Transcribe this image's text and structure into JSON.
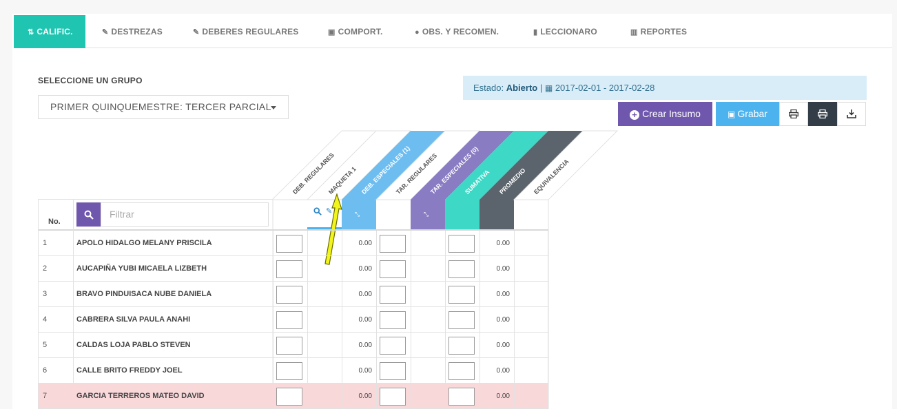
{
  "tabs": [
    {
      "label": "CALIFIC.",
      "icon": "sort-icon",
      "active": true
    },
    {
      "label": "DESTREZAS",
      "icon": "edit-icon"
    },
    {
      "label": "DEBERES REGULARES",
      "icon": "edit-icon"
    },
    {
      "label": "COMPORT.",
      "icon": "comment-box-icon"
    },
    {
      "label": "OBS. Y RECOMEN.",
      "icon": "comments-icon"
    },
    {
      "label": "LECCIONARO",
      "icon": "book-icon"
    },
    {
      "label": "REPORTES",
      "icon": "bar-chart-icon"
    }
  ],
  "group": {
    "label": "SELECCIONE UN GRUPO",
    "selected": "PRIMER QUINQUEMESTRE: TERCER PARCIAL"
  },
  "estado": {
    "prefix": "Estado:",
    "value": "Abierto",
    "separator": "|",
    "range": "2017-02-01 - 2017-02-28"
  },
  "actions": {
    "crear": "Crear Insumo",
    "grabar": "Grabar"
  },
  "table": {
    "no_header": "No.",
    "filter_placeholder": "Filtrar",
    "columns": [
      "DEB. REGULARES",
      "MAQUETA 1",
      "DEB. ESPECIALES (1)",
      "TAR. REGULARES",
      "TAR. ESPECIALES (0)",
      "SUMATIVA",
      "PROMEDIO",
      "EQUIVALENCIA"
    ],
    "rows": [
      {
        "no": "1",
        "name": "APOLO HIDALGO MELANY PRISCILA",
        "deb_esp": "0.00",
        "promedio": "0.00"
      },
      {
        "no": "2",
        "name": "AUCAPIÑA YUBI MICAELA LIZBETH",
        "deb_esp": "0.00",
        "promedio": "0.00"
      },
      {
        "no": "3",
        "name": "BRAVO PINDUISACA NUBE DANIELA",
        "deb_esp": "0.00",
        "promedio": "0.00"
      },
      {
        "no": "4",
        "name": "CABRERA SILVA PAULA ANAHI",
        "deb_esp": "0.00",
        "promedio": "0.00"
      },
      {
        "no": "5",
        "name": "CALDAS LOJA PABLO STEVEN",
        "deb_esp": "0.00",
        "promedio": "0.00"
      },
      {
        "no": "6",
        "name": "CALLE BRITO FREDDY JOEL",
        "deb_esp": "0.00",
        "promedio": "0.00"
      },
      {
        "no": "7",
        "name": "GARCIA TERREROS MATEO DAVID",
        "deb_esp": "0.00",
        "promedio": "0.00"
      }
    ]
  },
  "colors": {
    "teal": "#1fc5b1",
    "blue": "#6dbdf1",
    "purple": "#8a7cc2",
    "aqua": "#3ed8c6",
    "slate": "#5b646c",
    "highlight_row": "#f9d8da"
  }
}
